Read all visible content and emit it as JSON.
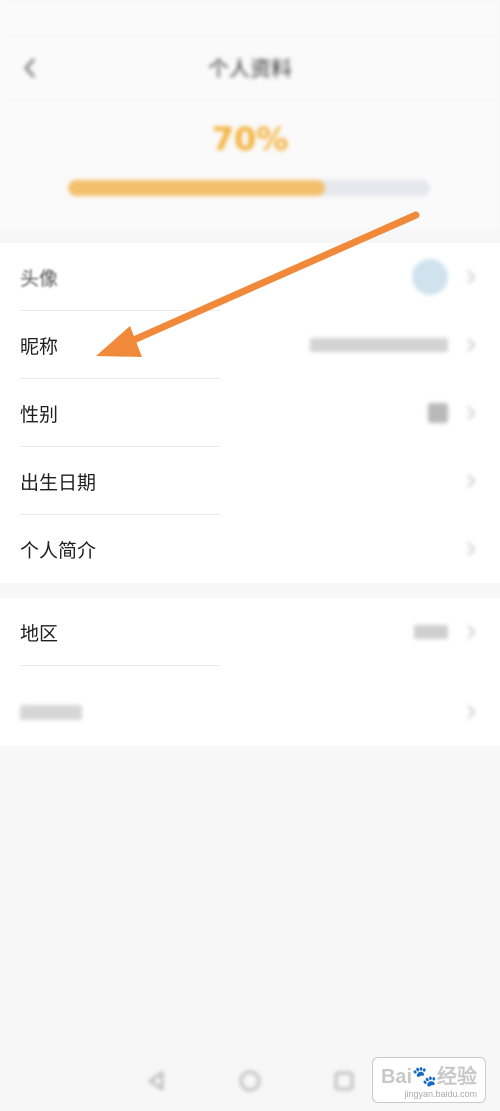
{
  "status_bar": {
    "left_text": "",
    "right_text": ""
  },
  "nav": {
    "title": "个人资料",
    "back_icon": "chevron-left-icon"
  },
  "completion": {
    "prefix": "",
    "percent_text": "70%",
    "suffix": "",
    "progress": 0.71
  },
  "profile": {
    "avatar": {
      "label": "头像"
    },
    "nickname": {
      "label": "昵称"
    },
    "gender": {
      "label": "性别"
    },
    "birthday": {
      "label": "出生日期"
    },
    "bio": {
      "label": "个人简介"
    }
  },
  "extra": {
    "region": {
      "label": "地区"
    },
    "third": {
      "label": ""
    }
  },
  "system_nav": {
    "back_icon": "triangle-back-icon",
    "home_icon": "circle-home-icon",
    "recents_icon": "square-recents-icon"
  },
  "watermark": {
    "main": "Bai🐾经验",
    "sub": "jingyan.baidu.com"
  },
  "annotation": {
    "arrow_color": "#f0893a"
  }
}
